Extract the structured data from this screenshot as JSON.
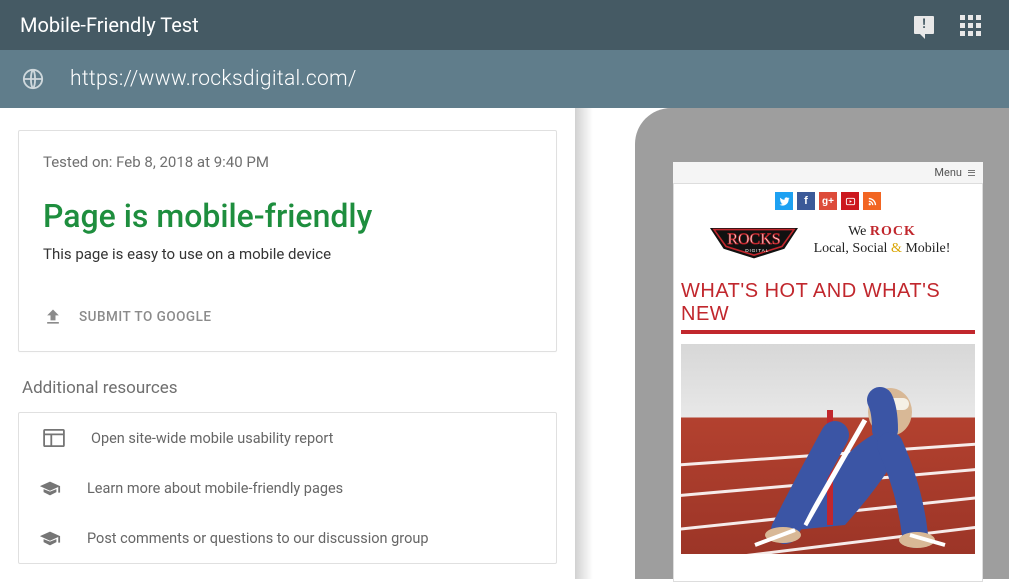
{
  "header": {
    "title": "Mobile-Friendly Test"
  },
  "urlbar": {
    "url": "https://www.rocksdigital.com/"
  },
  "result": {
    "tested_on": "Tested on: Feb 8, 2018 at 9:40 PM",
    "status_title": "Page is mobile-friendly",
    "status_sub": "This page is easy to use on a mobile device",
    "submit_label": "SUBMIT TO GOOGLE"
  },
  "resources": {
    "title": "Additional resources",
    "items": [
      "Open site-wide mobile usability report",
      "Learn more about mobile-friendly pages",
      "Post comments or questions to our discussion group"
    ]
  },
  "preview": {
    "menu_label": "Menu",
    "tagline_pre": "We ",
    "tagline_rock": "ROCK",
    "tagline_line2a": "Local, Social ",
    "tagline_amp": "&",
    "tagline_line2b": " Mobile!",
    "section_title": "WHAT'S HOT AND WHAT'S NEW"
  }
}
